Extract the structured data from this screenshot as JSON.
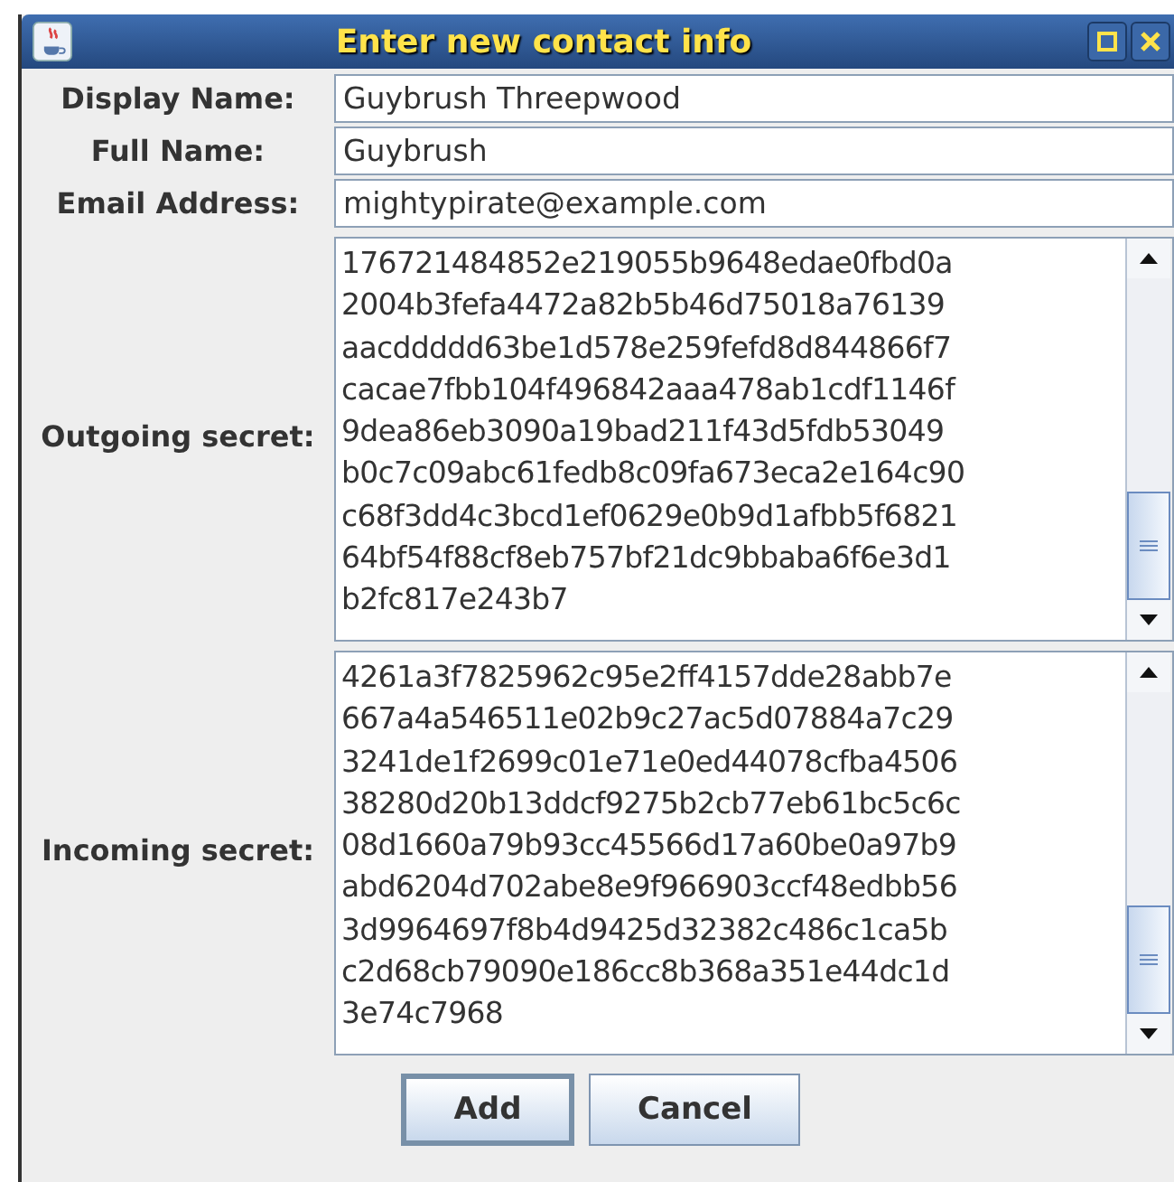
{
  "window": {
    "title": "Enter new contact info"
  },
  "fields": [
    {
      "label": "Display Name:",
      "value": "Guybrush Threepwood"
    },
    {
      "label": "Full Name:",
      "value": "Guybrush"
    },
    {
      "label": "Email Address:",
      "value": "mightypirate@example.com"
    }
  ],
  "secrets": [
    {
      "label": "Outgoing secret:",
      "lines": [
        "176721484852e219055b9648edae0fbd0a",
        "2004b3fefa4472a82b5b46d75018a76139",
        "aacddddd63be1d578e259fefd8d844866f7",
        "cacae7fbb104f496842aaa478ab1cdf1146f",
        "9dea86eb3090a19bad211f43d5fdb53049",
        "b0c7c09abc61fedb8c09fa673eca2e164c90",
        "c68f3dd4c3bcd1ef0629e0b9d1afbb5f6821",
        "64bf54f88cf8eb757bf21dc9bbaba6f6e3d1",
        "b2fc817e243b7"
      ]
    },
    {
      "label": "Incoming secret:",
      "lines": [
        "4261a3f7825962c95e2ff4157dde28abb7e",
        "667a4a546511e02b9c27ac5d07884a7c29",
        "3241de1f2699c01e71e0ed44078cfba4506",
        "38280d20b13ddcf9275b2cb77eb61bc5c6c",
        "08d1660a79b93cc45566d17a60be0a97b9",
        "abd6204d702abe8e9f966903ccf48edbb56",
        "3d9964697f8b4d9425d32382c486c1ca5b",
        "c2d68cb79090e186cc8b368a351e44dc1d",
        "3e74c7968"
      ]
    }
  ],
  "buttons": [
    {
      "label": "Add",
      "default": true
    },
    {
      "label": "Cancel",
      "default": false
    }
  ]
}
